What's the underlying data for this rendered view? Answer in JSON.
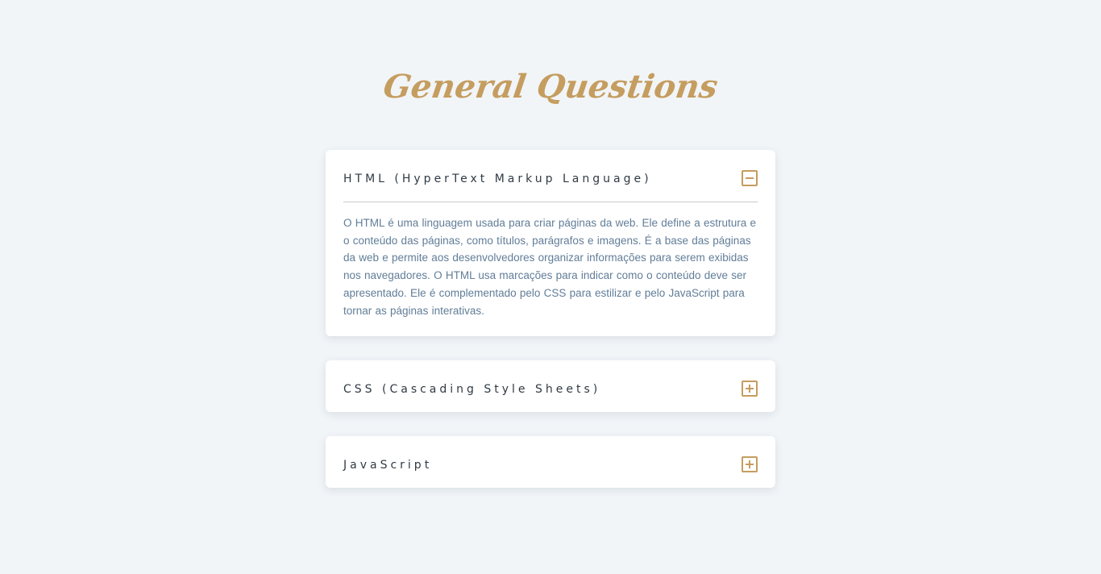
{
  "theme": {
    "accent": "#c59d5f",
    "text_dark": "#2f3a44",
    "text_muted": "#617d98",
    "background": "#f1f5f8",
    "card": "#ffffff"
  },
  "page": {
    "title": "General Questions"
  },
  "faq": {
    "items": [
      {
        "question": "HTML (HyperText Markup Language)",
        "answer": "O HTML é uma linguagem usada para criar páginas da web. Ele define a estrutura e o conteúdo das páginas, como títulos, parágrafos e imagens. É a base das páginas da web e permite aos desenvolvedores organizar informações para serem exibidas nos navegadores. O HTML usa marcações para indicar como o conteúdo deve ser apresentado. Ele é complementado pelo CSS para estilizar e pelo JavaScript para tornar as páginas interativas.",
        "expanded": true,
        "toggle_icon": "minus-square-icon"
      },
      {
        "question": "CSS (Cascading Style Sheets)",
        "expanded": false,
        "toggle_icon": "plus-square-icon"
      },
      {
        "question": "JavaScript",
        "expanded": false,
        "toggle_icon": "plus-square-icon"
      }
    ]
  }
}
